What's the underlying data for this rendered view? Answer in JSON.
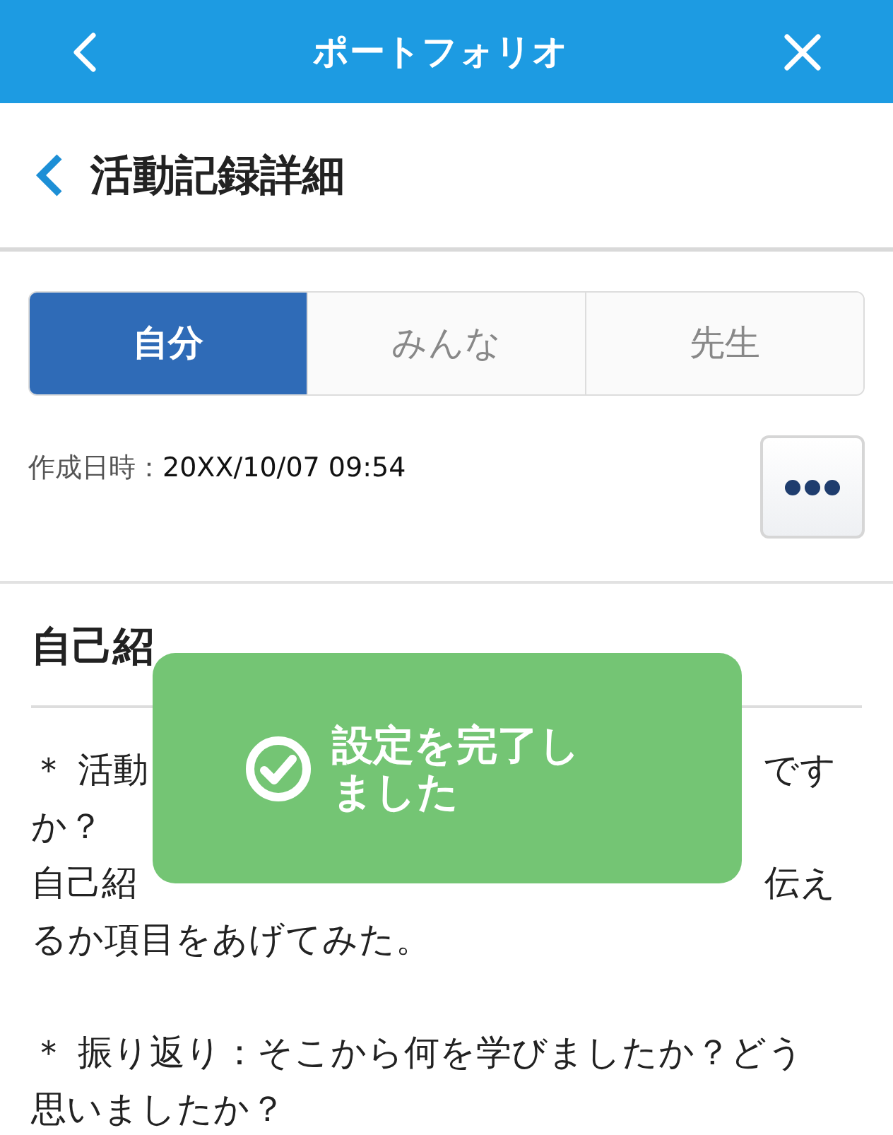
{
  "app_bar": {
    "title": "ポートフォリオ"
  },
  "page": {
    "title": "活動記録詳細"
  },
  "tabs": [
    {
      "label": "自分",
      "selected": true
    },
    {
      "label": "みんな",
      "selected": false
    },
    {
      "label": "先生",
      "selected": false
    }
  ],
  "created": {
    "label": "作成日時：",
    "value": "20XX/10/07 09:54"
  },
  "section": {
    "heading": "自己紹",
    "blocks": [
      [
        {
          "left": "＊ 活動",
          "right": "です"
        },
        {
          "left": "か？"
        },
        {
          "left": "自己紹",
          "right": "伝え"
        },
        {
          "left": "るか項目をあげてみた。"
        }
      ],
      [
        {
          "left": "＊ 振り返り：そこから何を学びましたか？どう"
        },
        {
          "left": "思いましたか？"
        }
      ]
    ]
  },
  "toast": {
    "message": "設定を完了しました"
  }
}
